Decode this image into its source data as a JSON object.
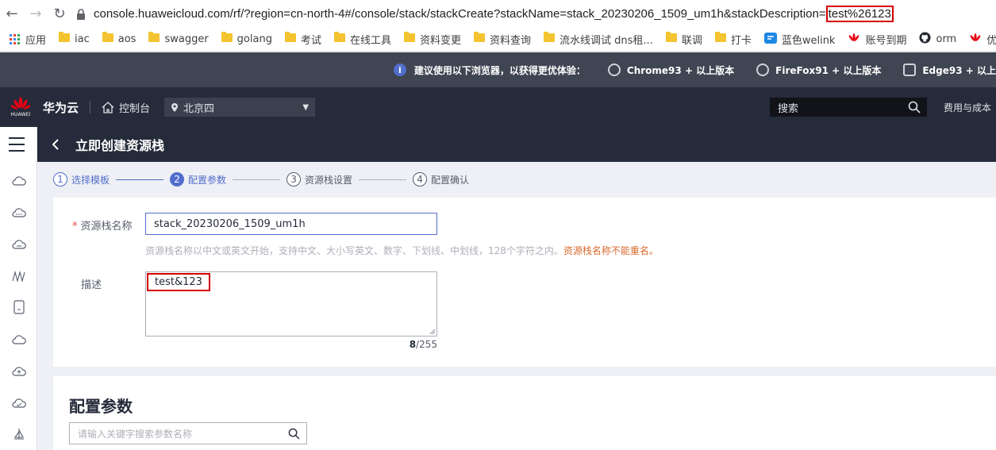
{
  "browser": {
    "url_prefix": "console.huaweicloud.com/rf/?region=cn-north-4#/console/stack/stackCreate?stackName=stack_20230206_1509_um1h&stackDescription=",
    "url_highlight": "test%26123",
    "bookmarks": [
      {
        "label": "应用",
        "icon": "apps-grid-icon"
      },
      {
        "label": "iac",
        "icon": "folder-icon"
      },
      {
        "label": "aos",
        "icon": "folder-icon"
      },
      {
        "label": "swagger",
        "icon": "folder-icon"
      },
      {
        "label": "golang",
        "icon": "folder-icon"
      },
      {
        "label": "考试",
        "icon": "folder-icon"
      },
      {
        "label": "在线工具",
        "icon": "folder-icon"
      },
      {
        "label": "资料变更",
        "icon": "folder-icon"
      },
      {
        "label": "资料查询",
        "icon": "folder-icon"
      },
      {
        "label": "流水线调试 dns租...",
        "icon": "folder-icon"
      },
      {
        "label": "联调",
        "icon": "folder-icon"
      },
      {
        "label": "打卡",
        "icon": "folder-icon"
      },
      {
        "label": "蓝色welink",
        "icon": "welink-icon"
      },
      {
        "label": "账号到期",
        "icon": "huawei-icon"
      },
      {
        "label": "orm",
        "icon": "github-icon"
      },
      {
        "label": "优",
        "icon": "huawei-icon"
      }
    ]
  },
  "banner": {
    "text": "建议使用以下浏览器，以获得更优体验：",
    "browsers": [
      "Chrome93 + 以上版本",
      "FireFox91 + 以上版本",
      "Edge93 + 以上"
    ]
  },
  "header": {
    "brand": "华为云",
    "logo_caption": "HUAWEI",
    "console": "控制台",
    "region": "北京四",
    "search_placeholder": "搜索",
    "costs": "费用与成本"
  },
  "page": {
    "title": "立即创建资源栈",
    "steps": [
      {
        "num": "1",
        "label": "选择模板",
        "state": "done"
      },
      {
        "num": "2",
        "label": "配置参数",
        "state": "active"
      },
      {
        "num": "3",
        "label": "资源栈设置",
        "state": "pending"
      },
      {
        "num": "4",
        "label": "配置确认",
        "state": "pending"
      }
    ]
  },
  "form": {
    "name_label": "资源栈名称",
    "name_value": "stack_20230206_1509_um1h",
    "name_hint": "资源栈名称以中文或英文开始，支持中文、大小写英文、数字、下划线、中划线，128个字符之内。",
    "name_warning": "资源栈名称不能重名。",
    "desc_label": "描述",
    "desc_value": "test&123",
    "desc_count": "8",
    "desc_max": "/255"
  },
  "params": {
    "title": "配置参数",
    "search_placeholder": "请输入关键字搜索参数名称"
  },
  "colors": {
    "highlight": "#d40000",
    "accent": "#526ecc",
    "header_bg": "#252b3a",
    "banner_bg": "#3f4552"
  }
}
